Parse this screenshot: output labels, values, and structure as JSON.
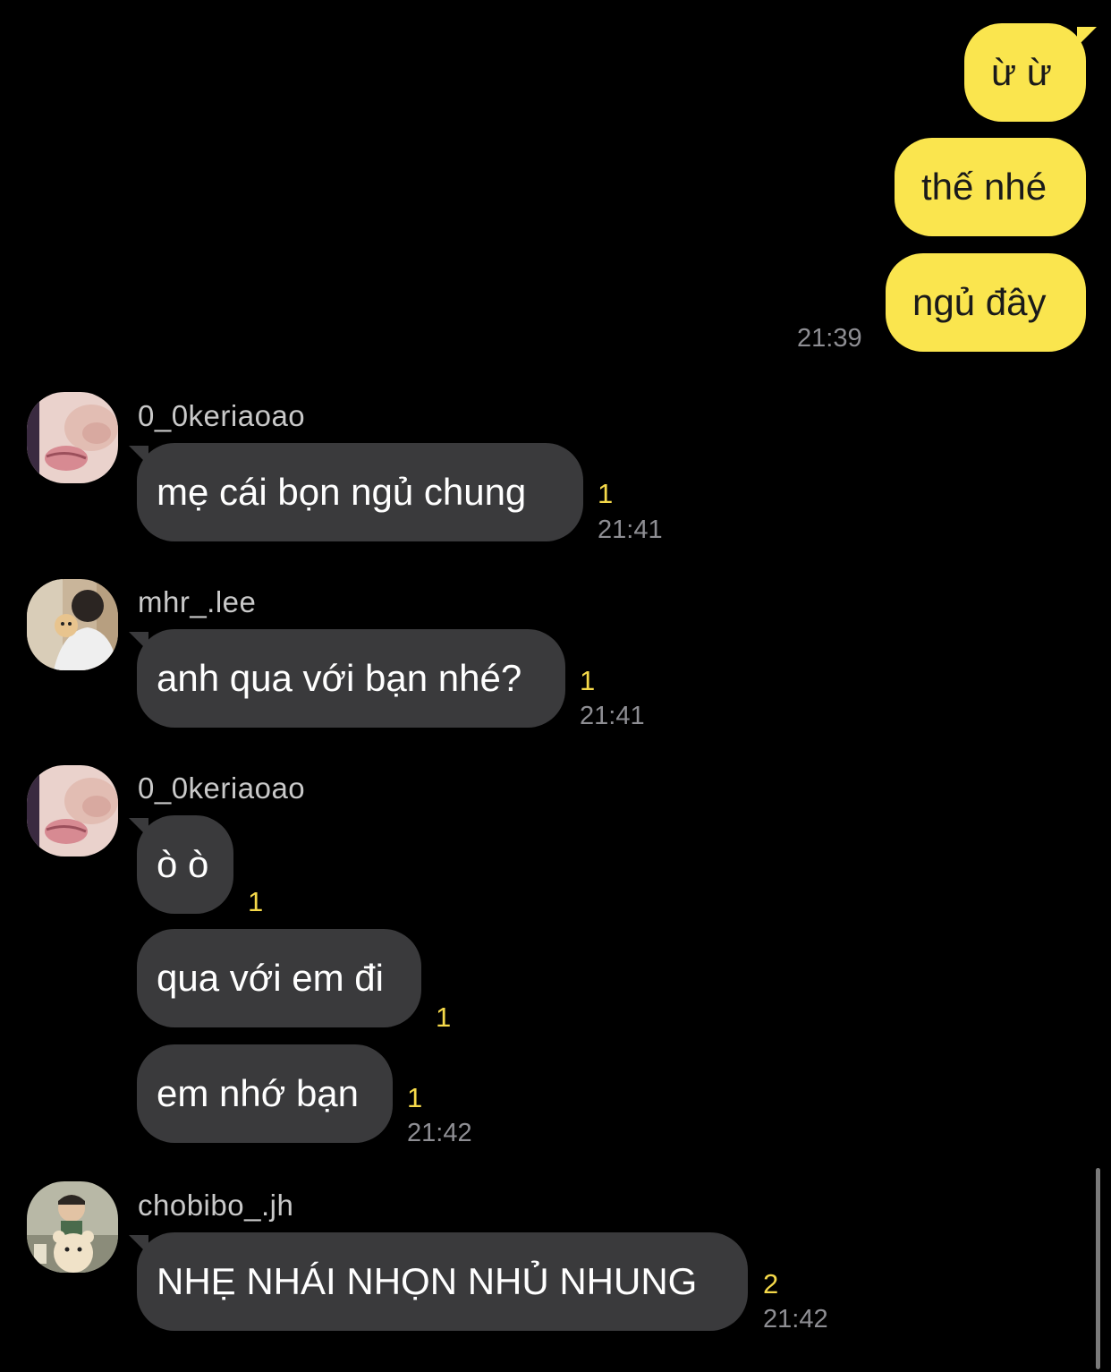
{
  "messages": {
    "out1": "ừ ừ",
    "out2": "thế nhé",
    "out3": "ngủ đây",
    "out_time": "21:39",
    "g1": {
      "sender": "0_0keriaoao",
      "text": "mẹ cái bọn ngủ chung",
      "unread": "1",
      "time": "21:41"
    },
    "g2": {
      "sender": "mhr_.lee",
      "text": "anh qua với bạn nhé?",
      "unread": "1",
      "time": "21:41"
    },
    "g3": {
      "sender": "0_0keriaoao",
      "text1": "ò ò",
      "unread1": "1",
      "text2": "qua với em đi",
      "unread2": "1",
      "text3": "em nhớ bạn",
      "unread3": "1",
      "time": "21:42"
    },
    "g4": {
      "sender": "chobibo_.jh",
      "text": "NHẸ NHÁI NHỌN NHỦ NHUNG",
      "unread": "2",
      "time": "21:42"
    }
  },
  "colors": {
    "background": "#000000",
    "outgoing_bubble": "#fae54e",
    "incoming_bubble": "#3a3a3c",
    "unread_count": "#f5d94a",
    "timestamp": "#8e8e93"
  },
  "icons": [
    "avatar-keriaoao",
    "avatar-mhr-lee",
    "avatar-chobibo"
  ]
}
